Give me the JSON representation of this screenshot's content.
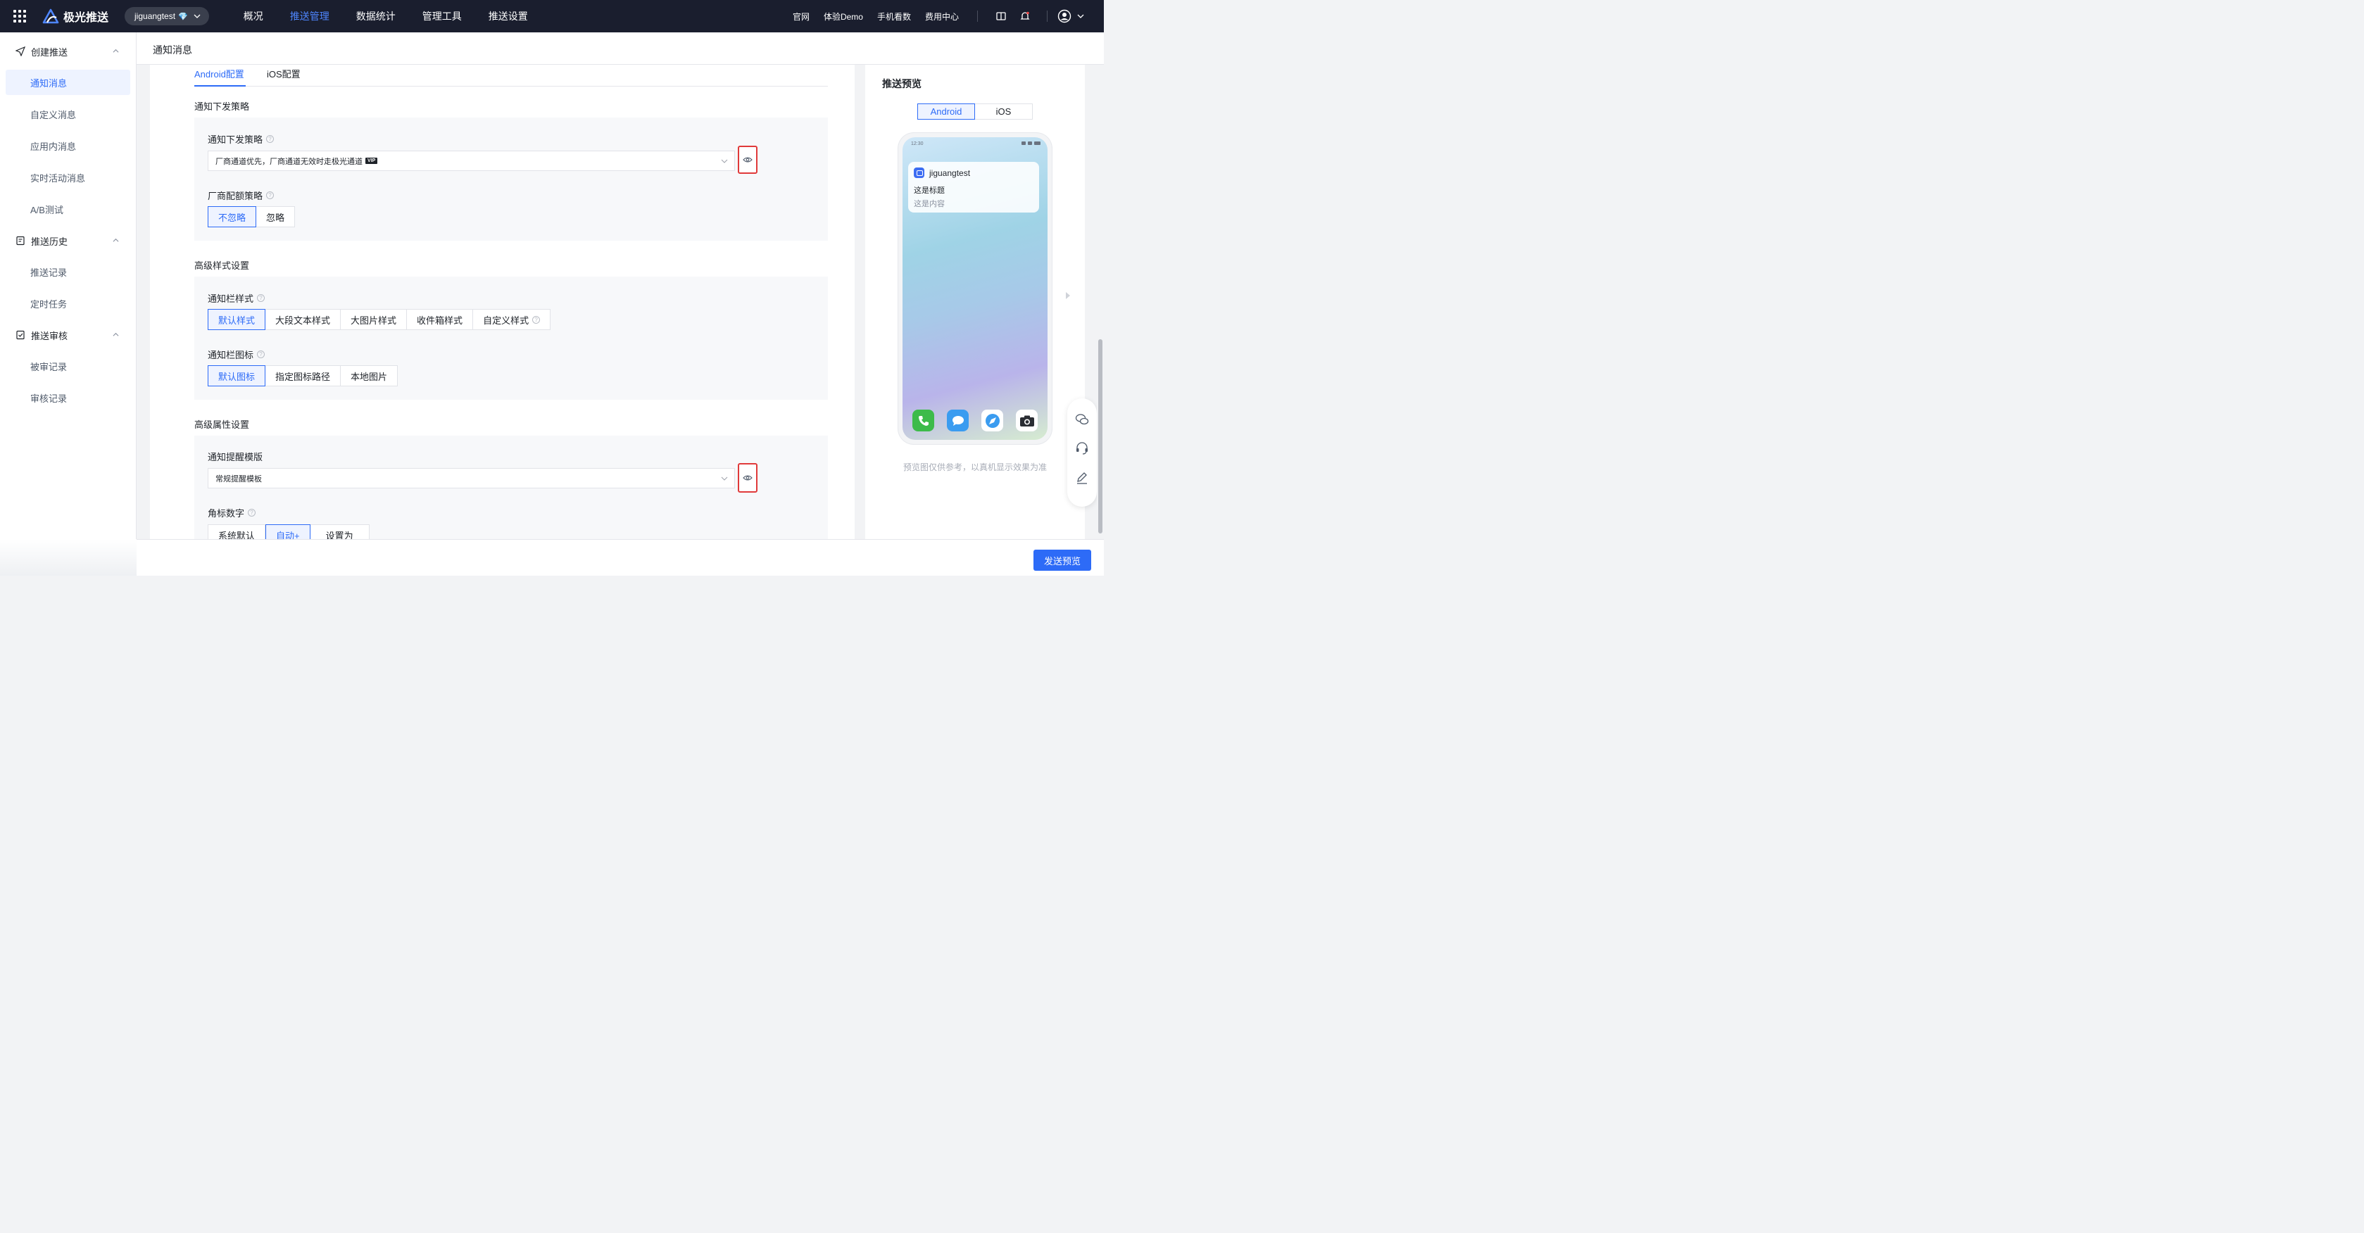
{
  "brand": {
    "name": "极光推送"
  },
  "account": {
    "name": "jiguangtest",
    "badge": "💎"
  },
  "nav": [
    {
      "label": "概况",
      "active": false
    },
    {
      "label": "推送管理",
      "active": true
    },
    {
      "label": "数据统计",
      "active": false
    },
    {
      "label": "管理工具",
      "active": false
    },
    {
      "label": "推送设置",
      "active": false
    }
  ],
  "top_links": [
    "官网",
    "体验Demo",
    "手机看数",
    "费用中心"
  ],
  "sidebar": {
    "groups": [
      {
        "label": "创建推送",
        "items": [
          "通知消息",
          "自定义消息",
          "应用内消息",
          "实时活动消息",
          "A/B测试"
        ],
        "active_item": "通知消息"
      },
      {
        "label": "推送历史",
        "items": [
          "推送记录",
          "定时任务"
        ]
      },
      {
        "label": "推送审核",
        "items": [
          "被审记录",
          "审核记录"
        ]
      }
    ]
  },
  "page": {
    "title": "通知消息"
  },
  "tabs": [
    {
      "label": "Android配置",
      "active": true
    },
    {
      "label": "iOS配置",
      "active": false
    }
  ],
  "sections": {
    "delivery": {
      "title": "通知下发策略",
      "strategy_label": "通知下发策略",
      "strategy_value": "厂商通道优先，厂商通道无效时走极光通道",
      "strategy_badge": "VIP",
      "quota_label": "厂商配额策略",
      "quota_options": [
        "不忽略",
        "忽略"
      ],
      "quota_selected": "不忽略"
    },
    "style": {
      "title": "高级样式设置",
      "bar_style_label": "通知栏样式",
      "bar_style_options": [
        "默认样式",
        "大段文本样式",
        "大图片样式",
        "收件箱样式",
        "自定义样式"
      ],
      "bar_style_selected": "默认样式",
      "icon_label": "通知栏图标",
      "icon_options": [
        "默认图标",
        "指定图标路径",
        "本地图片"
      ],
      "icon_selected": "默认图标"
    },
    "attributes": {
      "title": "高级属性设置",
      "reminder_label": "通知提醒模版",
      "reminder_value": "常规提醒模板",
      "badge_label": "角标数字",
      "badge_options": [
        "系统默认",
        "自动+",
        "设置为"
      ],
      "badge_selected": "自动+"
    }
  },
  "preview": {
    "title": "推送预览",
    "platforms": [
      "Android",
      "iOS"
    ],
    "selected_platform": "Android",
    "status_time": "12:30",
    "notification": {
      "app_name": "jiguangtest",
      "title": "这是标题",
      "body": "这是内容"
    },
    "note": "预览图仅供参考，以真机显示效果为准"
  },
  "bottom": {
    "send_preview_label": "发送预览"
  },
  "colors": {
    "primary": "#2d6bf7",
    "topbar": "#1a1e2e",
    "highlight_border": "#e03a3a"
  }
}
